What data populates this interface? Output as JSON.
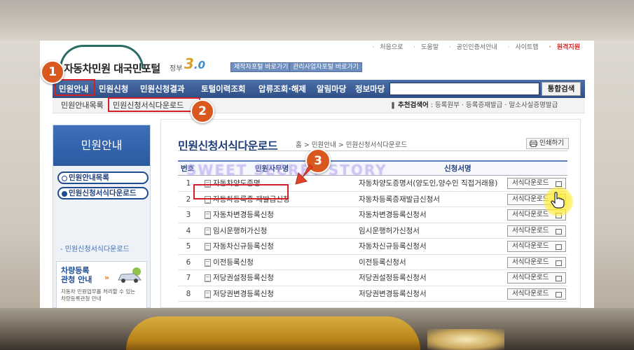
{
  "site": {
    "logo_text": "자동차민원 대국민포털",
    "gov_label": "정부",
    "gov_version_major": "3",
    "gov_version_minor": ".0",
    "portal_buttons": [
      "제작자포털 바로가기",
      "관리사업자포털 바로가기"
    ]
  },
  "top_links": [
    "처음으로",
    "도움말",
    "공인인증서안내",
    "사이트맵",
    "원격지원"
  ],
  "nav": {
    "items": [
      "민원안내",
      "민원신청",
      "민원신청결과",
      "토털이력조회",
      "압류조회·해제",
      "알림마당",
      "정보마당"
    ],
    "search_placeholder": "",
    "search_button": "통합검색"
  },
  "subnav": {
    "items": [
      "민원안내목록",
      "민원신청서식다운로드"
    ],
    "keywords_label": "추천검색어",
    "keywords": ": 등록원부 · 등록증재발급 · 말소사실증명발급"
  },
  "sidebar": {
    "title": "민원안내",
    "items": [
      "민원안내목록",
      "민원신청서식다운로드"
    ],
    "sub_item": "- 민원신청서식다운로드",
    "promo_title_1": "차량등록",
    "promo_title_2": "관청 안내",
    "promo_arrow": "»",
    "promo_desc_1": "자동차 민원업무를 처리할 수 있는",
    "promo_desc_2": "차량등록관청 안내"
  },
  "content": {
    "title": "민원신청서식다운로드",
    "breadcrumb": "홈 > 민원안내 > 민원신청서식다운로드",
    "print_button": "인쇄하기",
    "watermark": "SWEET SECRET STORY",
    "columns": [
      "번호",
      "민원사무명",
      "신청서명"
    ],
    "download_label": "서식다운로드",
    "rows": [
      {
        "no": "1",
        "name": "자동차양도증명",
        "form": "자동차양도증명서(양도인,양수인 직접거래용)"
      },
      {
        "no": "2",
        "name": "자동차등록증 재발급신청",
        "form": "자동차등록증재발급신청서"
      },
      {
        "no": "3",
        "name": "자동차변경등록신청",
        "form": "자동차변경등록신청서"
      },
      {
        "no": "4",
        "name": "임시운행허가신청",
        "form": "임시운행허가신청서"
      },
      {
        "no": "5",
        "name": "자동차신규등록신청",
        "form": "자동차신규등록신청서"
      },
      {
        "no": "6",
        "name": "이전등록신청",
        "form": "이전등록신청서"
      },
      {
        "no": "7",
        "name": "저당권설정등록신청",
        "form": "저당권설정등록신청서"
      },
      {
        "no": "8",
        "name": "저당권변경등록신청",
        "form": "저당권변경등록신청서"
      }
    ]
  },
  "annotations": {
    "badges": [
      "1",
      "2",
      "3"
    ],
    "badge_color": "#d9581f",
    "box_color": "#d21f2a"
  },
  "colors": {
    "nav": "#2f4f86",
    "accent": "#1f3f7a",
    "cursor_highlight": "#ffee3c"
  }
}
